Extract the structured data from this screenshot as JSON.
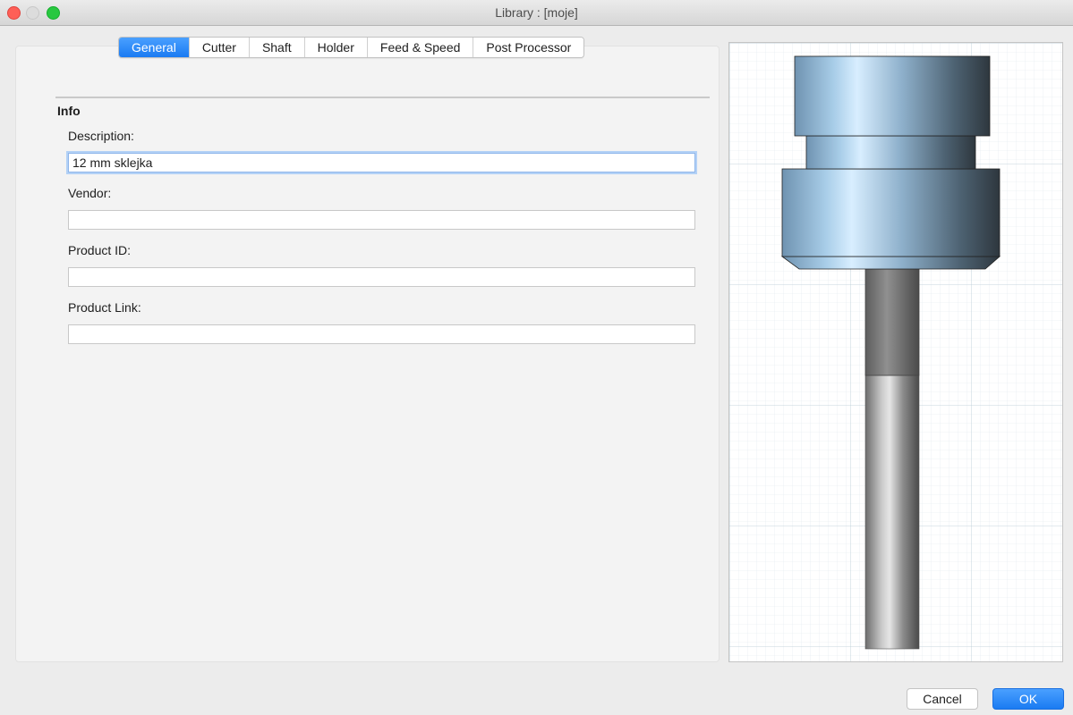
{
  "window": {
    "title": "Library : [moje]"
  },
  "tabs": [
    {
      "label": "General",
      "active": true
    },
    {
      "label": "Cutter",
      "active": false
    },
    {
      "label": "Shaft",
      "active": false
    },
    {
      "label": "Holder",
      "active": false
    },
    {
      "label": "Feed & Speed",
      "active": false
    },
    {
      "label": "Post Processor",
      "active": false
    }
  ],
  "info": {
    "section_title": "Info",
    "description_label": "Description:",
    "description_value": "12 mm sklejka",
    "vendor_label": "Vendor:",
    "vendor_value": "",
    "product_id_label": "Product ID:",
    "product_id_value": "",
    "product_link_label": "Product Link:",
    "product_link_value": ""
  },
  "buttons": {
    "cancel": "Cancel",
    "ok": "OK"
  },
  "colors": {
    "accent": "#1a7bf2",
    "holder": "#8fb3cf",
    "shaft": "#8a8a8a"
  }
}
